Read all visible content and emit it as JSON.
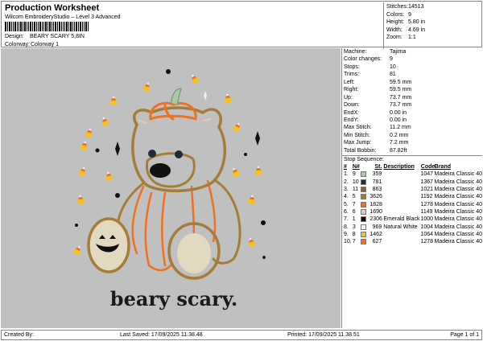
{
  "header": {
    "title": "Production Worksheet",
    "subtitle": "Wilcom EmbroideryStudio – Level 3 Advanced",
    "design_label": "Design:",
    "design_value": "BEARY SCARY 5,8IN",
    "colorway_label": "Colorway:",
    "colorway_value": "Colorway 1"
  },
  "stats": [
    {
      "label": "Stitches:",
      "value": "14513"
    },
    {
      "label": "Colors:",
      "value": "9"
    },
    {
      "label": "Height:",
      "value": "5.80 in"
    },
    {
      "label": "Width:",
      "value": "4.69 in"
    },
    {
      "label": "Zoom:",
      "value": "1:1"
    }
  ],
  "properties": [
    {
      "label": "Machine:",
      "value": "Tajima"
    },
    {
      "label": "Color changes:",
      "value": "9"
    },
    {
      "label": "Stops:",
      "value": "10"
    },
    {
      "label": "Trims:",
      "value": "81"
    },
    {
      "label": "Left:",
      "value": "59.5 mm"
    },
    {
      "label": "Right:",
      "value": "59.5 mm"
    },
    {
      "label": "Up:",
      "value": "73.7 mm"
    },
    {
      "label": "Down:",
      "value": "73.7 mm"
    },
    {
      "label": "EndX:",
      "value": "0.00 in"
    },
    {
      "label": "EndY:",
      "value": "0.00 in"
    },
    {
      "label": "Max Stitch:",
      "value": "11.2 mm"
    },
    {
      "label": "Min Stitch:",
      "value": "0.2 mm"
    },
    {
      "label": "Max Jump:",
      "value": "7.2 mm"
    },
    {
      "label": "Total Bobbin:",
      "value": "87.82ft"
    }
  ],
  "stop_sequence": {
    "title": "Stop Sequence:",
    "headers": [
      "#",
      "N#",
      "St.",
      "Description",
      "Code",
      "Brand"
    ],
    "rows": [
      {
        "n": "1.",
        "num": "9",
        "color": "#a9c9a3",
        "st": "359",
        "desc": "",
        "code": "1047",
        "brand": "Madeira Classic 40"
      },
      {
        "n": "2.",
        "num": "10",
        "color": "#1f2a3a",
        "st": "781",
        "desc": "",
        "code": "1367",
        "brand": "Madeira Classic 40"
      },
      {
        "n": "3.",
        "num": "11",
        "color": "#b9502a",
        "st": "863",
        "desc": "",
        "code": "1021",
        "brand": "Madeira Classic 40"
      },
      {
        "n": "4.",
        "num": "5",
        "color": "#a57d38",
        "st": "3626",
        "desc": "",
        "code": "1192",
        "brand": "Madeira Classic 40"
      },
      {
        "n": "5.",
        "num": "7",
        "color": "#f0701e",
        "st": "1828",
        "desc": "",
        "code": "1278",
        "brand": "Madeira Classic 40"
      },
      {
        "n": "6.",
        "num": "6",
        "color": "#e3cbb5",
        "st": "1690",
        "desc": "",
        "code": "1149",
        "brand": "Madeira Classic 40"
      },
      {
        "n": "7.",
        "num": "1",
        "color": "#0a0a0a",
        "st": "2306",
        "desc": "Emerald Black",
        "code": "1000",
        "brand": "Madeira Classic 40"
      },
      {
        "n": "8.",
        "num": "3",
        "color": "#f2f2f2",
        "st": "969",
        "desc": "Natural White",
        "code": "1004",
        "brand": "Madeira Classic 40"
      },
      {
        "n": "9.",
        "num": "8",
        "color": "#f5c21a",
        "st": "1462",
        "desc": "",
        "code": "1064",
        "brand": "Madeira Classic 40"
      },
      {
        "n": "10.",
        "num": "7",
        "color": "#f0701e",
        "st": "627",
        "desc": "",
        "code": "1278",
        "brand": "Madeira Classic 40"
      }
    ]
  },
  "design": {
    "lettering": "beary scary.",
    "background": "#c0c0c0"
  },
  "footer": {
    "created_by": "Created By:",
    "last_saved": "Last Saved: 17/09/2025 11.38.48",
    "printed": "Printed: 17/09/2025 11.38.51",
    "page": "Page 1 of 1"
  }
}
